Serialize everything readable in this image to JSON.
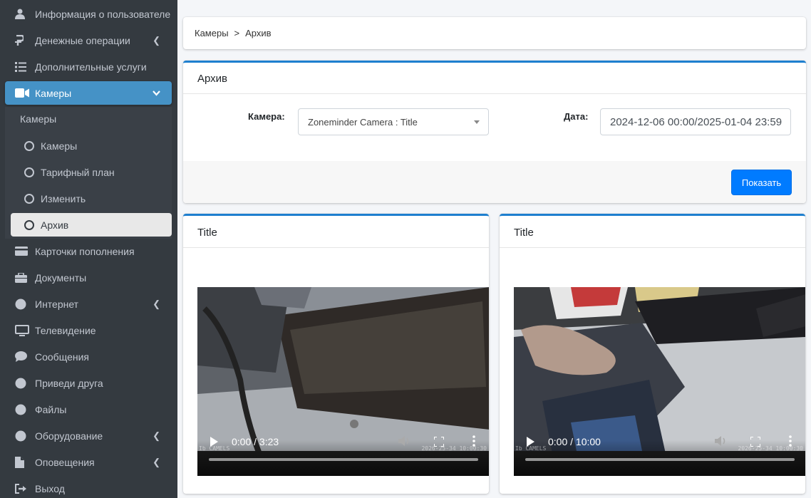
{
  "sidebar": {
    "items": [
      {
        "label": "Информация о пользователе",
        "icon": "user-icon",
        "chevron": false
      },
      {
        "label": "Денежные операции",
        "icon": "money-icon",
        "chevron": true
      },
      {
        "label": "Дополнительные услуги",
        "icon": "list-icon",
        "chevron": false
      },
      {
        "label": "Камеры",
        "icon": "video-camera-icon",
        "chevron": true,
        "active": true
      },
      {
        "label": "Карточки пополнения",
        "icon": "card-icon",
        "chevron": false
      },
      {
        "label": "Документы",
        "icon": "briefcase-icon",
        "chevron": false
      },
      {
        "label": "Интернет",
        "icon": "circle-icon",
        "chevron": true
      },
      {
        "label": "Телевидение",
        "icon": "tv-icon",
        "chevron": false
      },
      {
        "label": "Сообщения",
        "icon": "comment-icon",
        "chevron": false
      },
      {
        "label": "Приведи друга",
        "icon": "circle-icon",
        "chevron": false
      },
      {
        "label": "Файлы",
        "icon": "circle-icon",
        "chevron": false
      },
      {
        "label": "Оборудование",
        "icon": "circle-icon",
        "chevron": true
      },
      {
        "label": "Оповещения",
        "icon": "file-icon",
        "chevron": true
      },
      {
        "label": "Выход",
        "icon": "sign-out-icon",
        "chevron": false
      }
    ],
    "submenu": {
      "header": "Камеры",
      "items": [
        {
          "label": "Камеры"
        },
        {
          "label": "Тарифный план"
        },
        {
          "label": "Изменить"
        },
        {
          "label": "Архив",
          "selected": true
        }
      ]
    }
  },
  "breadcrumb": {
    "parent": "Камеры",
    "separator": ">",
    "current": "Архив"
  },
  "filter": {
    "title": "Архив",
    "camera_label": "Камера:",
    "camera_value": "Zoneminder Camera : Title",
    "date_label": "Дата:",
    "date_value": "2024-12-06 00:00/2025-01-04 23:59",
    "show_button": "Показать"
  },
  "videos": [
    {
      "title": "Title",
      "time": "0:00 / 3:23",
      "progress": 0
    },
    {
      "title": "Title",
      "time": "0:00 / 10:00",
      "progress": 0
    }
  ],
  "colors": {
    "sidebar_bg": "#343a40",
    "active": "#4592c6",
    "primary": "#007bff",
    "accent": "#1e7fcf"
  }
}
